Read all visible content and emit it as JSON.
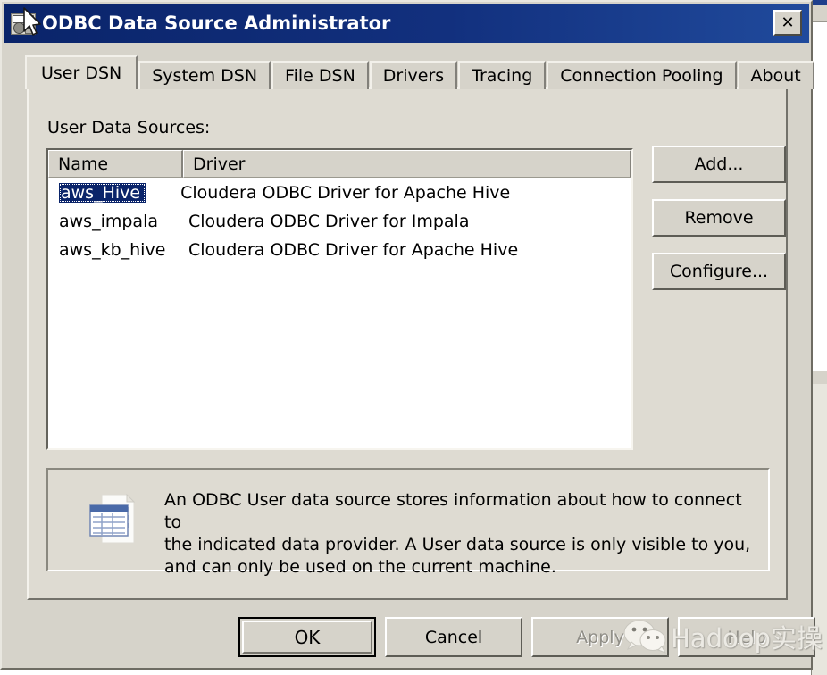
{
  "window": {
    "title": "ODBC Data Source Administrator",
    "icon": "odbc-icon",
    "close_label": "✕"
  },
  "tabs": [
    {
      "label": "User DSN",
      "active": true
    },
    {
      "label": "System DSN",
      "active": false
    },
    {
      "label": "File DSN",
      "active": false
    },
    {
      "label": "Drivers",
      "active": false
    },
    {
      "label": "Tracing",
      "active": false
    },
    {
      "label": "Connection Pooling",
      "active": false
    },
    {
      "label": "About",
      "active": false
    }
  ],
  "page": {
    "sources_label": "User Data Sources:",
    "columns": [
      {
        "key": "name",
        "label": "Name"
      },
      {
        "key": "driver",
        "label": "Driver"
      }
    ],
    "rows": [
      {
        "name": "aws_Hive",
        "driver": "Cloudera ODBC Driver for Apache Hive",
        "selected": true
      },
      {
        "name": "aws_impala",
        "driver": "Cloudera ODBC Driver for Impala",
        "selected": false
      },
      {
        "name": "aws_kb_hive",
        "driver": "Cloudera ODBC Driver for Apache Hive",
        "selected": false
      }
    ],
    "side_buttons": {
      "add": "Add...",
      "remove": "Remove",
      "configure": "Configure..."
    },
    "description": {
      "icon": "data-source-table-icon",
      "text": "An ODBC User data source stores information about how to connect to\nthe indicated data provider.   A User data source is only visible to you,\nand can only be used on the current machine."
    }
  },
  "bottom_buttons": {
    "ok": "OK",
    "cancel": "Cancel",
    "apply": "Apply",
    "apply_enabled": false,
    "help": "Help",
    "help_enabled": false
  },
  "watermark": {
    "icon": "wechat-icon",
    "text": "Hadoop实操"
  },
  "colors": {
    "title_bar": "#0a246a",
    "dialog_face": "#d6d3ca",
    "page_face": "#dedbd2",
    "selection": "#0a246a",
    "list_background": "#ffffff",
    "disabled_text": "#908e87"
  }
}
